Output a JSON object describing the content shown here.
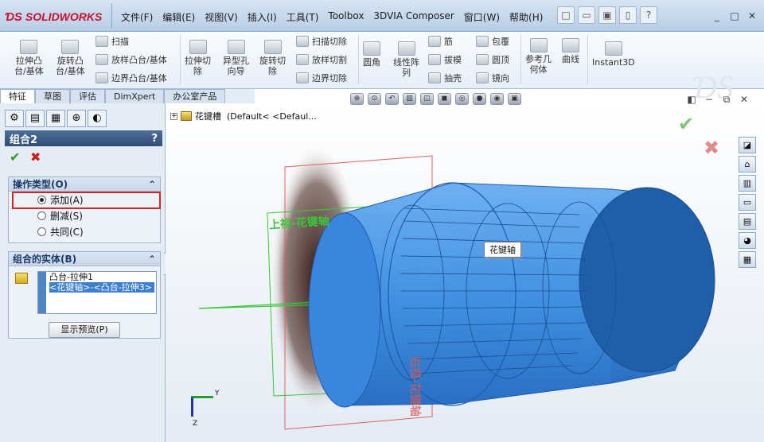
{
  "app": {
    "logo": "SOLIDWORKS",
    "menus": [
      "文件(F)",
      "编辑(E)",
      "视图(V)",
      "插入(I)",
      "工具(T)",
      "Toolbox",
      "3DVIA Composer",
      "窗口(W)",
      "帮助(H)"
    ],
    "window_controls": [
      "_",
      "□",
      "✕"
    ]
  },
  "ribbon": {
    "extrude_boss": "拉伸凸\n台/基体",
    "revolve_boss": "旋转凸\n台/基体",
    "sweep": "扫描",
    "loft_boss": "放样凸台/基体",
    "boundary_boss": "边界凸台/基体",
    "extrude_cut": "拉伸切\n除",
    "hole_wizard": "异型孔\n向导",
    "revolve_cut": "旋转切\n除",
    "sweep_cut": "扫描切除",
    "loft_cut": "放样切割",
    "boundary_cut": "边界切除",
    "fillet": "圆角",
    "linear_pattern": "线性阵\n列",
    "rib": "筋",
    "draft": "拔模",
    "shell": "抽壳",
    "wrap": "包覆",
    "dome": "圆顶",
    "mirror": "镜向",
    "ref_geometry": "参考几\n何体",
    "curves": "曲线",
    "instant3d": "Instant3D"
  },
  "tabs": [
    "特征",
    "草图",
    "评估",
    "DimXpert",
    "办公室产品"
  ],
  "active_tab": 0,
  "property_manager": {
    "title": "组合2",
    "help": "?",
    "op_type_header": "操作类型(O)",
    "options": [
      "添加(A)",
      "删减(S)",
      "共同(C)"
    ],
    "selected_option": 0,
    "bodies_header": "组合的实体(B)",
    "bodies": [
      "凸台-拉伸1",
      "<花键轴>-<凸台-拉伸3>"
    ],
    "preview_button": "显示预览(P)"
  },
  "tree": {
    "item": "花键槽",
    "config": "(Default< <Defaul..."
  },
  "viewport": {
    "tooltip": "花键轴",
    "plane_top": "上视-花键轴",
    "plane_side": "右视-花键轴",
    "axis_y": "Y",
    "axis_z": "Z"
  },
  "colors": {
    "body_blue": "#3f8fe0",
    "brand_red": "#c8102e"
  }
}
